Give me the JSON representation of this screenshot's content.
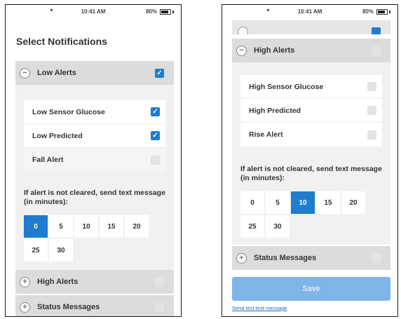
{
  "status_bar": {
    "signal": "▼",
    "time": "10:41 AM",
    "battery_label": "80%",
    "battery_level": 0.8
  },
  "left": {
    "title": "Select Notifications",
    "low_alerts": {
      "label": "Low Alerts",
      "icon": "minus-circle-icon",
      "checked": true,
      "items": [
        {
          "label": "Low Sensor Glucose",
          "checked": true,
          "disabled": false
        },
        {
          "label": "Low Predicted",
          "checked": true,
          "disabled": false
        },
        {
          "label": "Fall Alert",
          "checked": false,
          "disabled": true
        }
      ],
      "message_label": "If alert is not cleared, send text message (in minutes):",
      "options": [
        "0",
        "5",
        "10",
        "15",
        "20",
        "25",
        "30"
      ],
      "selected_option": "0"
    },
    "high_alerts": {
      "label": "High Alerts",
      "icon": "plus-circle-icon",
      "checked": false
    },
    "status_messages": {
      "label": "Status Messages",
      "icon": "plus-circle-icon",
      "checked": false
    }
  },
  "right": {
    "high_alerts": {
      "label": "High Alerts",
      "icon": "minus-circle-icon",
      "checked": false,
      "items": [
        {
          "label": "High Sensor Glucose",
          "checked": false
        },
        {
          "label": "High Predicted",
          "checked": false
        },
        {
          "label": "Rise Alert",
          "checked": false
        }
      ],
      "message_label": "If alert is not cleared, send text message (in minutes):",
      "options": [
        "0",
        "5",
        "10",
        "15",
        "20",
        "25",
        "30"
      ],
      "selected_option": "10"
    },
    "status_messages": {
      "label": "Status Messages",
      "icon": "plus-circle-icon",
      "checked": false
    },
    "save_label": "Save",
    "test_link": "Send test text message"
  },
  "colors": {
    "accent": "#1f7ccf",
    "save_button": "#7fb6ea",
    "section_bg": "#dcdcdc",
    "panel_bg": "#f1f1f1"
  }
}
